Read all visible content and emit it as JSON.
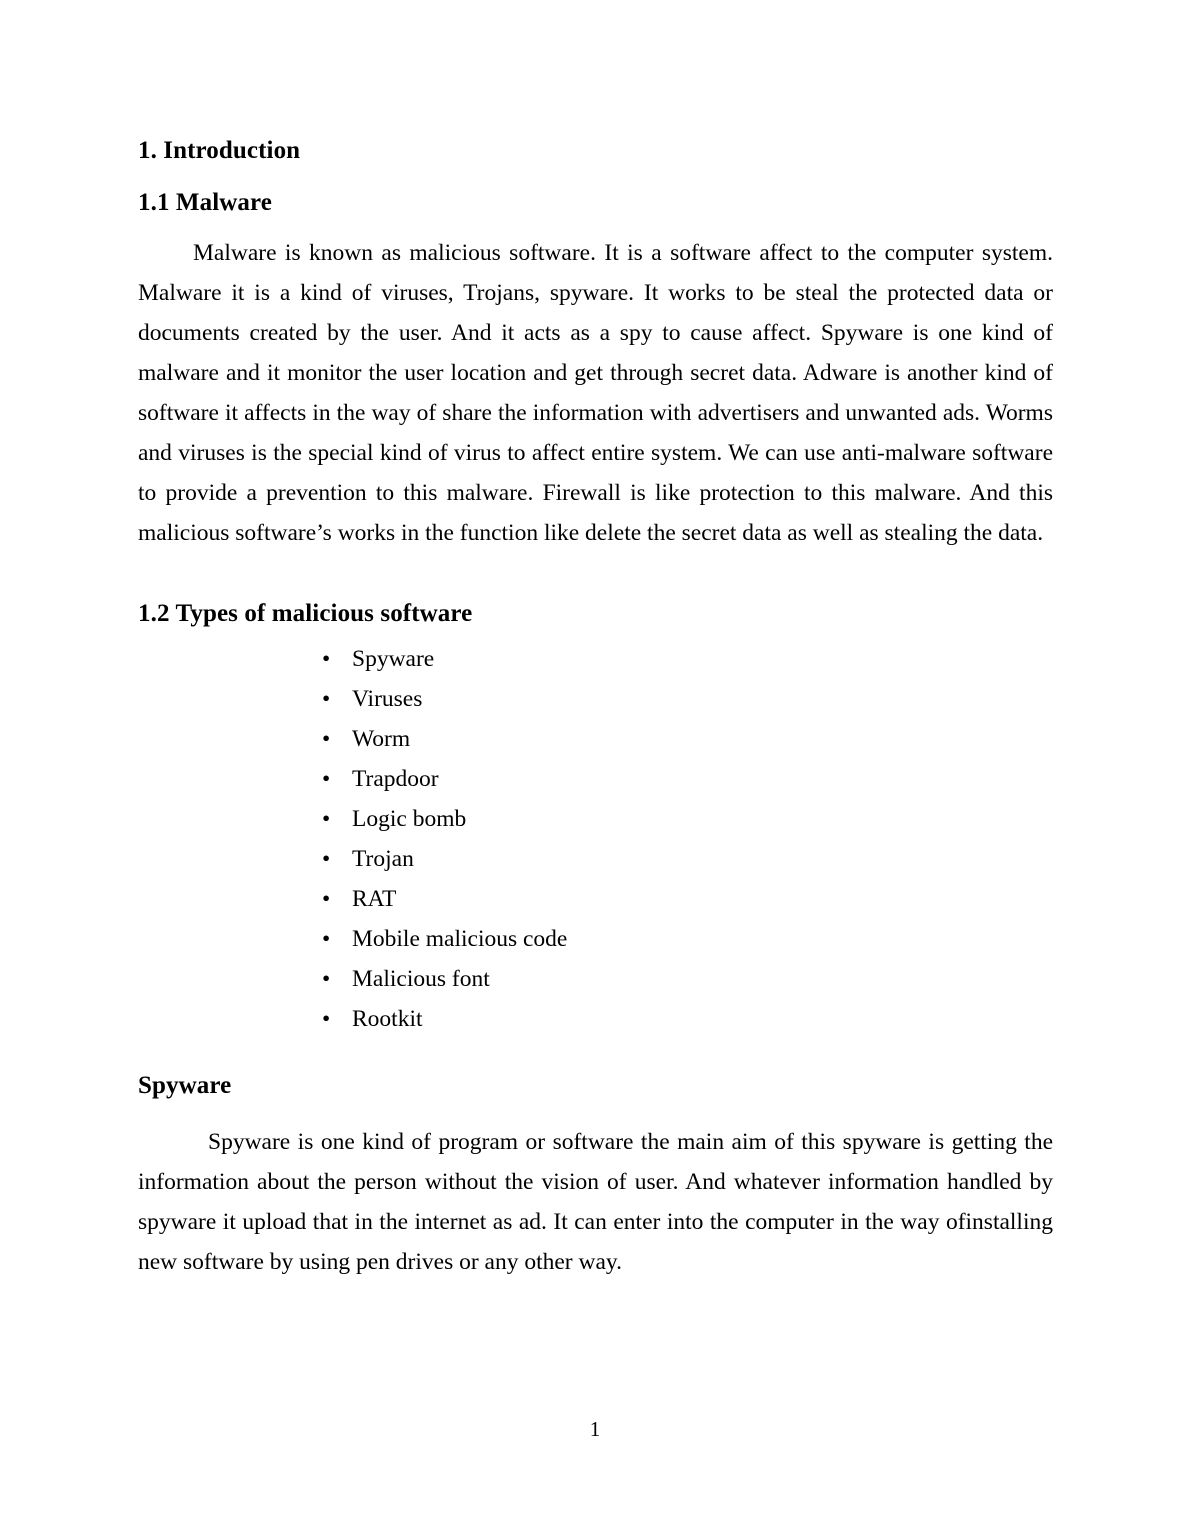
{
  "document": {
    "background_color": "#ffffff",
    "text_color": "#000000",
    "page_number": "1"
  },
  "sections": {
    "chapter_heading": "1. Introduction",
    "malware_heading": "1.1 Malware",
    "malware_paragraph": "Malware is known as malicious software. It is a software affect to the computer system. Malware it is a kind of viruses, Trojans, spyware. It works to be steal the protected data or documents created by the user. And it acts as a spy to cause affect. Spyware is one kind of malware and it monitor the user location and get through secret data. Adware is another kind of software it affects in the way of share the information with advertisers and unwanted ads. Worms and viruses is the special kind of virus to affect entire system. We can use anti-malware software to provide a prevention to this malware. Firewall is like protection to this malware. And this malicious software’s works in the function like delete the secret data as well as stealing the data.",
    "types_heading": "1.2 Types of malicious software",
    "types_list": [
      "Spyware",
      "Viruses",
      "Worm",
      "Trapdoor",
      "Logic bomb",
      "Trojan",
      "RAT",
      "Mobile malicious code",
      "Malicious font",
      "Rootkit"
    ],
    "spyware_heading": "Spyware",
    "spyware_paragraph": "Spyware is one kind of program or software the main aim of this spyware is getting the information about the person without the vision of user. And whatever information handled by spyware it upload that in the internet as ad. It can enter into the computer in the way ofinstalling new software by using pen drives or any other way."
  },
  "bullet_glyph": "•"
}
